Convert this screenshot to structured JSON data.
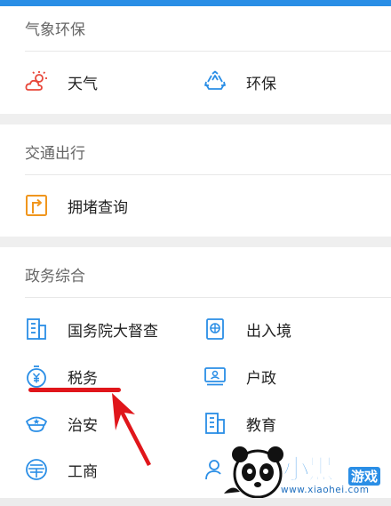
{
  "colors": {
    "accent_blue": "#2a8ee6",
    "accent_orange": "#f0961e",
    "weather_red": "#e8473a",
    "annotation_red": "#e0161b"
  },
  "sections": [
    {
      "title": "气象环保",
      "items": [
        {
          "label": "天气",
          "icon": "weather-cloud-sun-icon"
        },
        {
          "label": "环保",
          "icon": "recycle-icon"
        }
      ]
    },
    {
      "title": "交通出行",
      "items": [
        {
          "label": "拥堵查询",
          "icon": "traffic-sign-icon"
        }
      ]
    },
    {
      "title": "政务综合",
      "items": [
        {
          "label": "国务院大督查",
          "icon": "building-icon"
        },
        {
          "label": "出入境",
          "icon": "passport-icon"
        },
        {
          "label": "税务",
          "icon": "yuan-coin-icon"
        },
        {
          "label": "户政",
          "icon": "id-card-icon"
        },
        {
          "label": "治安",
          "icon": "police-cap-icon"
        },
        {
          "label": "教育",
          "icon": "school-building-icon"
        },
        {
          "label": "工商",
          "icon": "business-icon"
        },
        {
          "label": "",
          "icon": "person-icon"
        }
      ]
    }
  ],
  "watermark": {
    "brand": "小黑",
    "game": "游戏",
    "url": "www.xiaohei.com"
  }
}
